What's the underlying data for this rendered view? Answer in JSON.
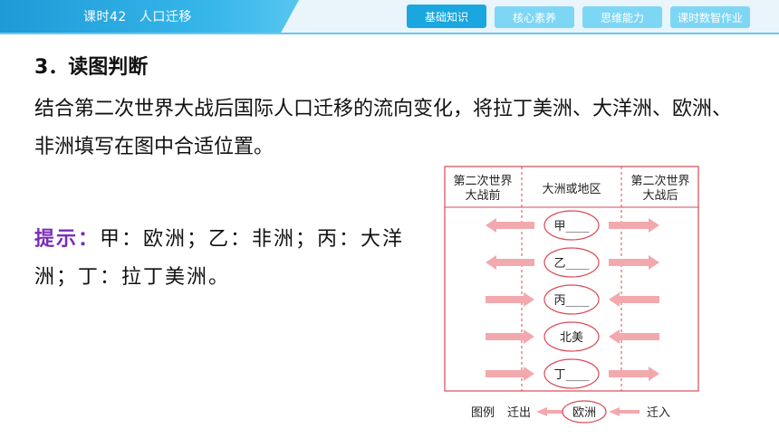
{
  "header": {
    "lesson_code": "课时42",
    "lesson_name": "人口迁移",
    "tabs": [
      "基础知识",
      "核心素养",
      "思维能力",
      "课时数智作业"
    ],
    "active_tab": 0,
    "accent": "#1aa7e0"
  },
  "question": {
    "title": "3．读图判断",
    "text": "结合第二次世界大战后国际人口迁移的流向变化，将拉丁美洲、大洋洲、欧洲、非洲填写在图中合适位置。"
  },
  "hint": {
    "label": "提示：",
    "text": "甲：欧洲；乙：非洲；丙：大洋洲；丁：拉丁美洲。",
    "label_color": "#7a2db8"
  },
  "diagram": {
    "col_before": [
      "第二次世界",
      "大战前"
    ],
    "col_middle": "大洲或地区",
    "col_after": [
      "第二次世界",
      "大战后"
    ],
    "rows": [
      {
        "label": "甲____",
        "before": "out",
        "after": "out"
      },
      {
        "label": "乙____",
        "before": "out",
        "after": "out"
      },
      {
        "label": "丙____",
        "before": "in",
        "after": "in"
      },
      {
        "label": "北美",
        "before": "in",
        "after": "in"
      },
      {
        "label": "丁____",
        "before": "in",
        "after": "out"
      }
    ],
    "arrow_color": "#f2a9ad"
  },
  "legend": {
    "title": "图例",
    "out_label": "迁出",
    "sample": "欧洲",
    "in_label": "迁入"
  }
}
